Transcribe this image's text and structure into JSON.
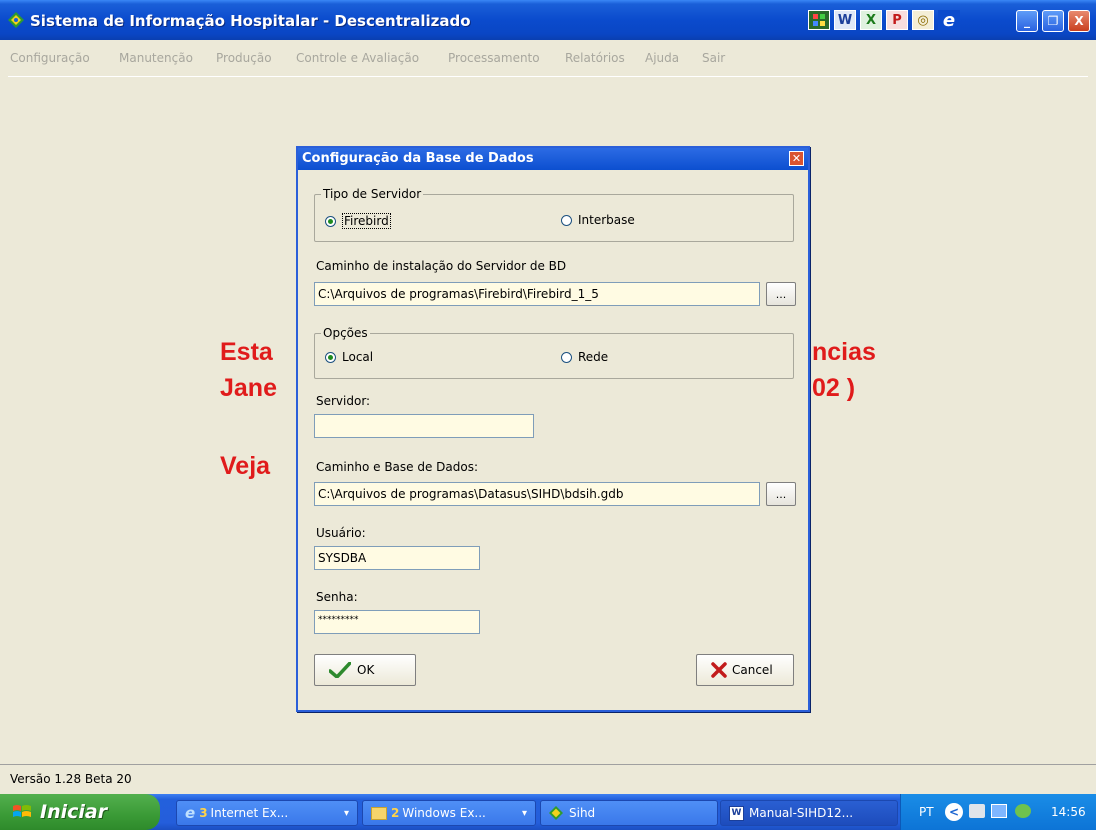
{
  "window": {
    "title": "Sistema de Informação Hospitalar - Descentralizado",
    "controls": {
      "minimize": "_",
      "restore": "❐",
      "close": "X"
    },
    "app_buttons": [
      "tile",
      "word",
      "excel",
      "powerpoint",
      "outlook",
      "internet-explorer"
    ]
  },
  "menu": [
    "Configuração",
    "Manutenção",
    "Produção",
    "Controle e Avaliação",
    "Processamento",
    "Relatórios",
    "Ajuda",
    "Sair"
  ],
  "background_text": {
    "line1_left": "Esta",
    "line1_right": "ncias",
    "line2_left": "Jane",
    "line2_right": "02 )",
    "line3_left": "Veja"
  },
  "dialog": {
    "title": "Configuração da Base de Dados",
    "server_type_group": {
      "label": "Tipo de Servidor",
      "options": [
        "Firebird",
        "Interbase"
      ],
      "selected": "Firebird"
    },
    "server_path_label": "Caminho de instalação do Servidor de BD",
    "server_path_value": "C:\\Arquivos de programas\\Firebird\\Firebird_1_5",
    "browse_label": "...",
    "options_group": {
      "label": "Opções",
      "options": [
        "Local",
        "Rede"
      ],
      "selected": "Local"
    },
    "server_label": "Servidor:",
    "server_value": "",
    "db_path_label": "Caminho e Base de Dados:",
    "db_path_value": "C:\\Arquivos de programas\\Datasus\\SIHD\\bdsih.gdb",
    "user_label": "Usuário:",
    "user_value": "SYSDBA",
    "password_label": "Senha:",
    "password_value": "*********",
    "ok_label": "OK",
    "cancel_label": "Cancel"
  },
  "status": {
    "version": "Versão 1.28 Beta 20"
  },
  "taskbar": {
    "start_label": "Iniciar",
    "tasks": [
      {
        "num": "3",
        "label": "Internet Ex...",
        "has_arrow": true
      },
      {
        "num": "2",
        "label": "Windows Ex...",
        "has_arrow": true
      },
      {
        "num": "",
        "label": "Sihd",
        "has_arrow": false
      },
      {
        "num": "",
        "label": "Manual-SIHD12...",
        "has_arrow": false
      }
    ],
    "language": "PT",
    "clock": "14:56"
  },
  "colors": {
    "title_blue": "#0b4bcd",
    "accent_red": "#e01b1b",
    "field_bg": "#fffbe3"
  }
}
